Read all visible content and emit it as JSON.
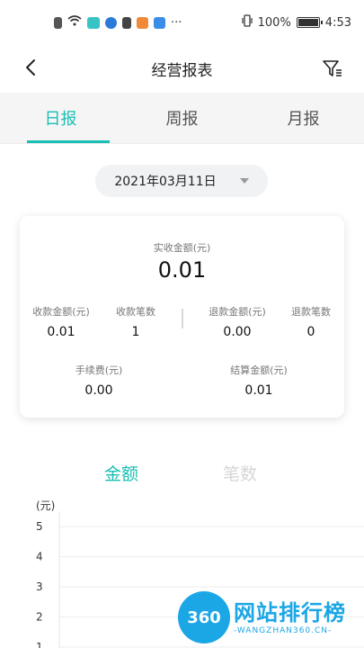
{
  "status_bar": {
    "battery_percent": "100%",
    "battery_level": 1.0,
    "time": "4:53",
    "more": "···"
  },
  "nav": {
    "title": "经营报表"
  },
  "tabs": [
    {
      "label": "日报",
      "active": true
    },
    {
      "label": "周报",
      "active": false
    },
    {
      "label": "月报",
      "active": false
    }
  ],
  "date_picker": {
    "value": "2021年03月11日"
  },
  "summary": {
    "real_income_label": "实收金额(元)",
    "real_income_value": "0.01",
    "collected_amount_label": "收款金额(元)",
    "collected_amount_value": "0.01",
    "collected_count_label": "收款笔数",
    "collected_count_value": "1",
    "refund_amount_label": "退款金额(元)",
    "refund_amount_value": "0.00",
    "refund_count_label": "退款笔数",
    "refund_count_value": "0",
    "fee_label": "手续费(元)",
    "fee_value": "0.00",
    "settle_label": "结算金额(元)",
    "settle_value": "0.01"
  },
  "chart_tabs": [
    {
      "label": "金额",
      "active": true
    },
    {
      "label": "笔数",
      "active": false
    }
  ],
  "colors": {
    "accent": "#19bfb3",
    "watermark": "#1ba6e6"
  },
  "chart_data": {
    "type": "line",
    "ylabel": "(元)",
    "ylim": [
      0,
      5
    ],
    "yticks": [
      "5",
      "4",
      "3",
      "2",
      "1"
    ],
    "series": [],
    "grid": true
  },
  "watermark": {
    "logo": "360",
    "text": "网站排行榜",
    "sub": "-WANGZHAN360.CN-"
  }
}
